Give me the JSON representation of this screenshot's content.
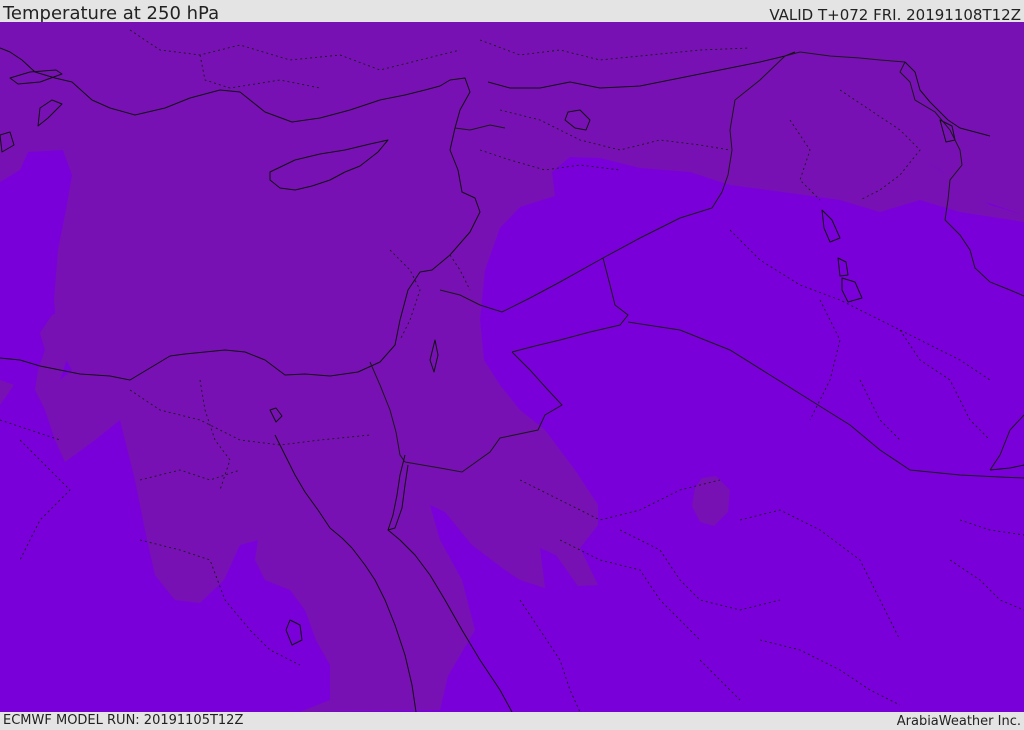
{
  "header": {
    "title": "Temperature at 250 hPa",
    "valid": "VALID T+072 FRI. 20191108T12Z"
  },
  "footer": {
    "model_run": "ECMWF MODEL RUN: 20191105T12Z",
    "credit": "ArabiaWeather Inc."
  },
  "map": {
    "colors": {
      "field_cold": "#7a00d9",
      "field_colder": "#7811b3",
      "coastline": "#111111",
      "border": "#1a1a1a"
    }
  }
}
